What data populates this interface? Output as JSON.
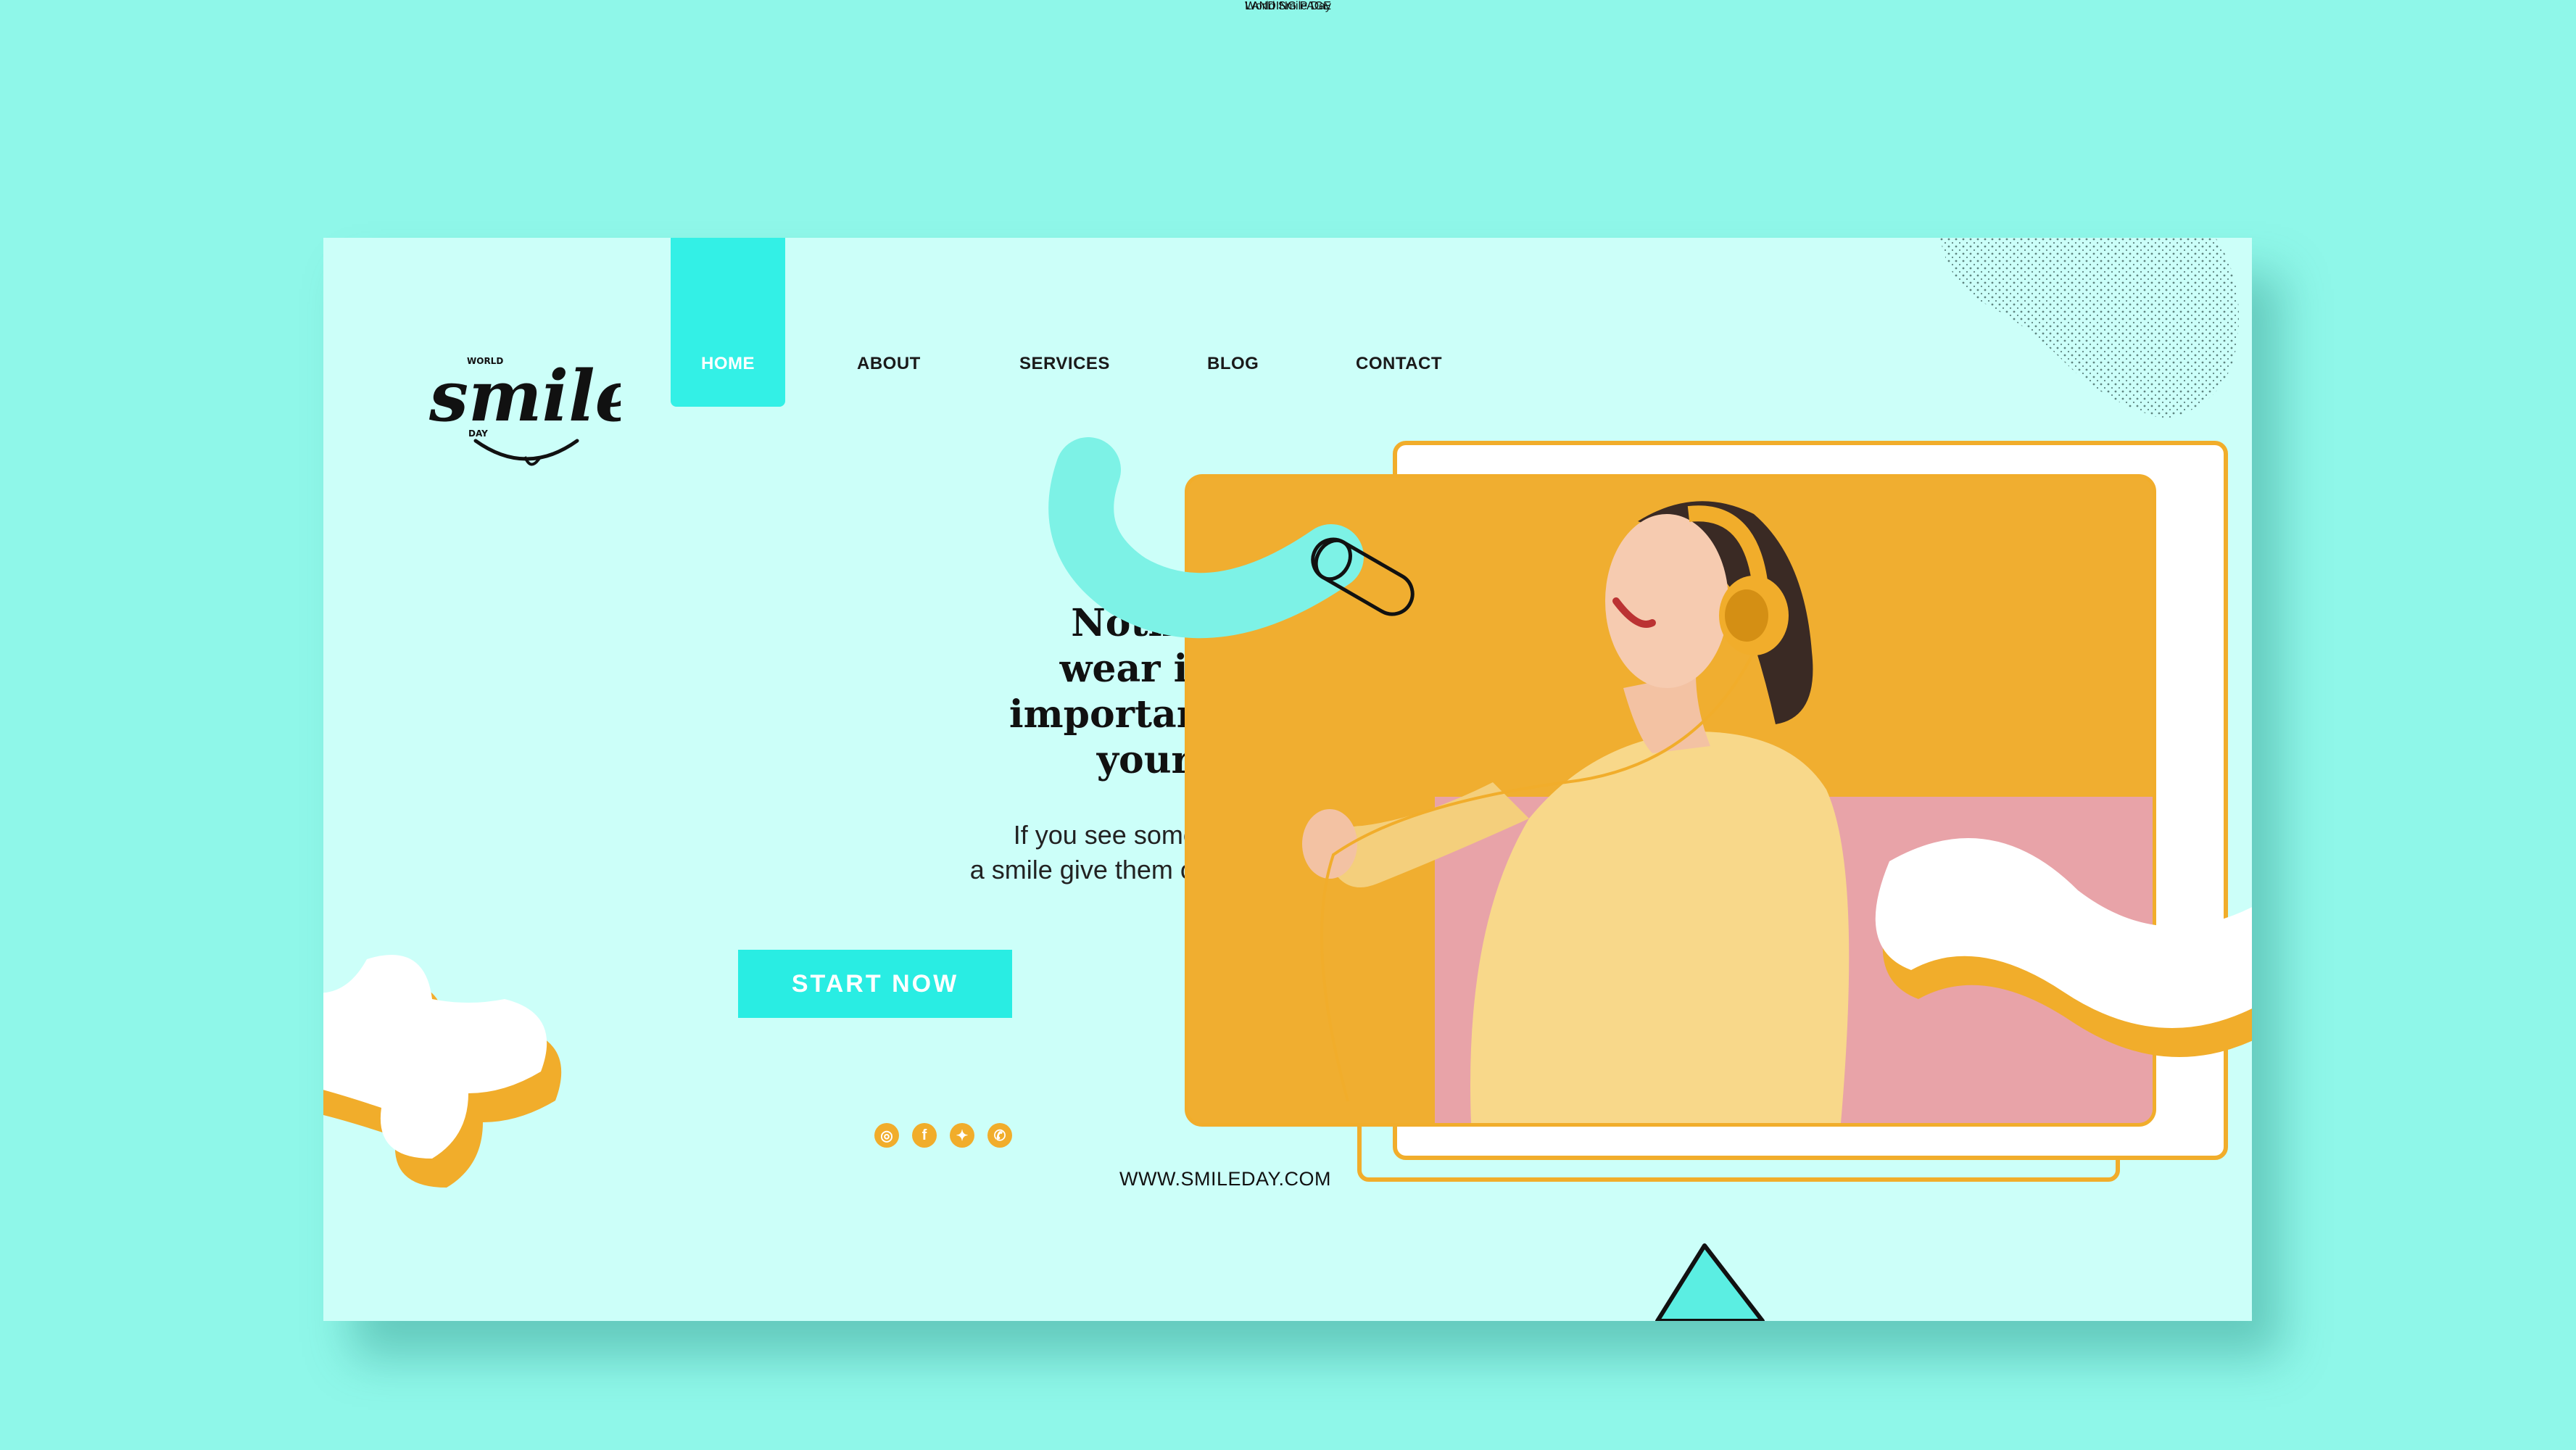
{
  "header": {
    "title": "LANDING PAGE",
    "subtitle": "World Smile Day"
  },
  "logo": {
    "small_top": "WORLD",
    "word": "smile",
    "small_bottom": "DAY"
  },
  "nav": [
    {
      "label": "HOME",
      "active": true
    },
    {
      "label": "ABOUT"
    },
    {
      "label": "SERVICES"
    },
    {
      "label": "BLOG"
    },
    {
      "label": "CONTACT"
    }
  ],
  "hero": {
    "headline": [
      "Nothing you",
      "wear is more",
      "important than",
      "your smile."
    ],
    "subtext": [
      "If you see someone without",
      "a smile give them one of yours."
    ],
    "cta_label": "START NOW"
  },
  "social": [
    {
      "name": "instagram-icon",
      "glyph": "◎"
    },
    {
      "name": "facebook-icon",
      "glyph": "f"
    },
    {
      "name": "twitter-icon",
      "glyph": "✦"
    },
    {
      "name": "whatsapp-icon",
      "glyph": "✆"
    }
  ],
  "website": "WWW.SMILEDAY.COM",
  "colors": {
    "background": "#8ff7e9",
    "card": "#ccfff9",
    "accent": "#29ede3",
    "orange": "#f1ad2b",
    "pink": "#e8a3a8"
  }
}
